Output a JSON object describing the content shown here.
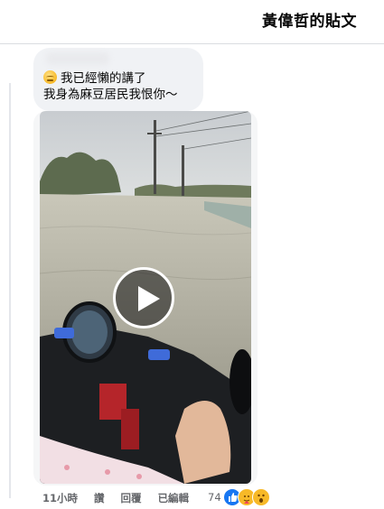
{
  "header": {
    "title": "黃偉哲的貼文"
  },
  "comment": {
    "line1": "我已經懶的講了",
    "line2": "我身為麻豆居民我恨你～",
    "leading_emoji": "relieved-face-emoji"
  },
  "video": {
    "play_icon": "play-icon"
  },
  "actions": {
    "time": "11小時",
    "like": "讚",
    "reply": "回覆",
    "edited": "已編輯"
  },
  "reactions": {
    "count": "74",
    "icons": [
      "like-icon",
      "care-icon",
      "wow-icon"
    ]
  },
  "colors": {
    "accent": "#1877f2",
    "bubble_bg": "#f0f2f5",
    "secondary_text": "#65676b"
  }
}
